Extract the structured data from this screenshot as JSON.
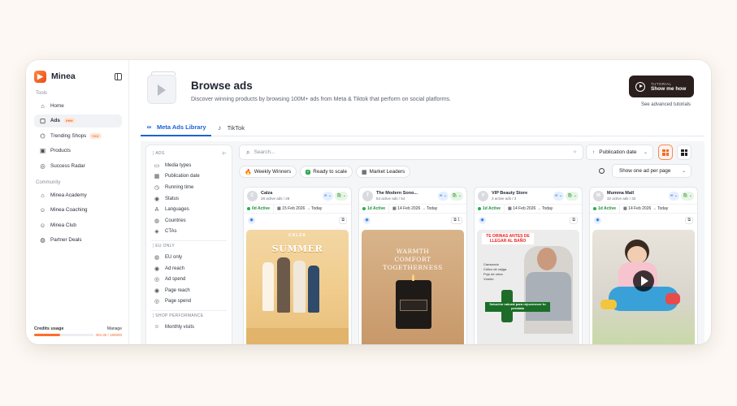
{
  "brand": {
    "name": "Minea"
  },
  "sidebar": {
    "tools_label": "Tools",
    "tools": [
      {
        "label": "Home",
        "icon": "home-icon",
        "glyph": "⌂"
      },
      {
        "label": "Ads",
        "icon": "ads-icon",
        "glyph": "▢",
        "badge": "new",
        "active": true
      },
      {
        "label": "Trending Shops",
        "icon": "trending-icon",
        "glyph": "⌬",
        "badge": "new"
      },
      {
        "label": "Products",
        "icon": "products-icon",
        "glyph": "▣"
      },
      {
        "label": "Success Radar",
        "icon": "radar-icon",
        "glyph": "◎"
      }
    ],
    "community_label": "Community",
    "community": [
      {
        "label": "Minea Academy",
        "icon": "academy-icon",
        "glyph": "⌂"
      },
      {
        "label": "Minea Coaching",
        "icon": "coaching-icon",
        "glyph": "☺"
      },
      {
        "label": "Minea Club",
        "icon": "club-icon",
        "glyph": "☺"
      },
      {
        "label": "Partner Deals",
        "icon": "globe-icon",
        "glyph": "◍"
      }
    ],
    "credits": {
      "label": "Credits usage",
      "manage": "Manage",
      "value": "404.30 / 150000",
      "fraction": 0.3
    }
  },
  "header": {
    "title": "Browse ads",
    "subtitle": "Discover winning products by browsing 100M+ ads from Meta & Tiktok that perform on social platforms.",
    "tutorial_top": "TUTORIAL",
    "tutorial_bottom": "Show me how",
    "advanced_link": "See advanced tutorials"
  },
  "tabs": [
    {
      "label": "Meta Ads Library",
      "active": true
    },
    {
      "label": "TikTok",
      "active": false
    }
  ],
  "filters": {
    "ads_label": "ADS",
    "ads": [
      {
        "label": "Media types",
        "glyph": "▭"
      },
      {
        "label": "Publication date",
        "glyph": "▦"
      },
      {
        "label": "Running time",
        "glyph": "◷"
      },
      {
        "label": "Status",
        "glyph": "◉"
      },
      {
        "label": "Languages",
        "glyph": "A"
      },
      {
        "label": "Countries",
        "glyph": "◍"
      },
      {
        "label": "CTAs",
        "glyph": "◈"
      }
    ],
    "eu_label": "EU ONLY",
    "eu": [
      {
        "label": "EU only",
        "glyph": "◍"
      },
      {
        "label": "Ad reach",
        "glyph": "◉"
      },
      {
        "label": "Ad spend",
        "glyph": "◎"
      },
      {
        "label": "Page reach",
        "glyph": "◉"
      },
      {
        "label": "Page spend",
        "glyph": "◎"
      }
    ],
    "shop_label": "SHOP PERFORMANCE",
    "shop": [
      {
        "label": "Monthly visits",
        "glyph": "☺"
      }
    ]
  },
  "toolbar": {
    "search_placeholder": "Search...",
    "sort_label": "Publication date",
    "chips": [
      "Weekly Winners",
      "Ready to scale",
      "Market Leaders"
    ],
    "ads_per_page": "Show one ad per page"
  },
  "cards": [
    {
      "name": "Calza",
      "sub": "28 active ads / 28",
      "initial": "C",
      "active": "0d Active",
      "dates": "15 Feb 2026 → Today",
      "copy": "⧉"
    },
    {
      "name": "The Modern Sono...",
      "sub": "54 active ads / 54",
      "initial": "T",
      "active": "1d Active",
      "dates": "14 Feb 2026 → Today",
      "copy": "⧉ 1"
    },
    {
      "name": "VIP Beauty Store",
      "sub": "3 active ads / 3",
      "initial": "V",
      "active": "1d Active",
      "dates": "14 Feb 2026 → Today",
      "copy": "⧉"
    },
    {
      "name": "Mumma Mall",
      "sub": "32 active ads / 32",
      "initial": "M",
      "active": "1d Active",
      "dates": "14 Feb 2026 → Today",
      "copy": "⧉"
    }
  ],
  "creatives": {
    "card1_brand": "CALZA",
    "card1_headline": "SUMMER",
    "card2_lines": [
      "WARMTH",
      "COMFORT",
      "TOGETHERNESS"
    ],
    "card3_headline": "TE ORINAS ANTES DE LLEGAR AL BAÑO",
    "card3_list": [
      "Cansancio",
      "Cólico de vejiga",
      "Pujo de orina",
      "Vómito"
    ],
    "card3_banner": "Solución natural para rejuvenecer tu próstata"
  }
}
